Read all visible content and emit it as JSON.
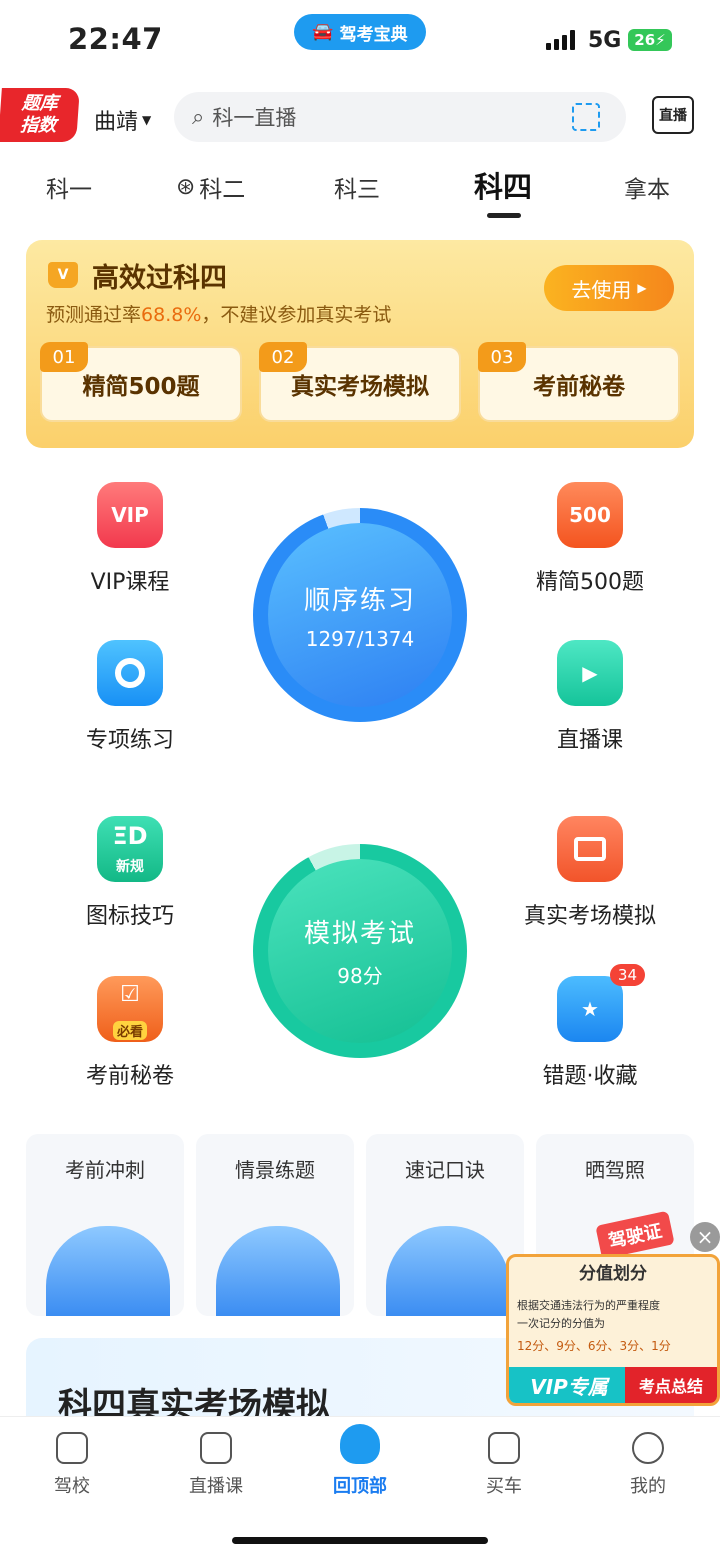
{
  "status_bar": {
    "time": "22:47",
    "app_name": "驾考宝典",
    "network": "5G",
    "battery": "26"
  },
  "header": {
    "badge_line1": "题库",
    "badge_line2": "指数",
    "city": "曲靖",
    "search_placeholder": "科一直播",
    "tv_label": "直播"
  },
  "tabs": [
    "科一",
    "科二",
    "科三",
    "科四",
    "拿本"
  ],
  "active_tab": "科四",
  "banner": {
    "title": "高效过科四",
    "subtitle_prefix": "预测通过率",
    "pass_rate": "68.8%",
    "subtitle_suffix": "，不建议参加真实考试",
    "button": "去使用",
    "cards": [
      {
        "num": "01",
        "label": "精简500题"
      },
      {
        "num": "02",
        "label": "真实考场模拟"
      },
      {
        "num": "03",
        "label": "考前秘卷"
      }
    ]
  },
  "features": {
    "vip": {
      "label": "VIP课程",
      "icon_text": "VIP"
    },
    "jingjian": {
      "label": "精简500题",
      "icon_text": "500"
    },
    "zhuanxiang": {
      "label": "专项练习"
    },
    "zhibo": {
      "label": "直播课"
    },
    "tubiao": {
      "label": "图标技巧",
      "icon_text": "新规"
    },
    "zhenshi": {
      "label": "真实考场模拟"
    },
    "mijuan": {
      "label": "考前秘卷",
      "icon_text": "必看"
    },
    "cuoti": {
      "label": "错题·收藏",
      "badge": "34"
    }
  },
  "practice_circle": {
    "title": "顺序练习",
    "progress": "1297/1374",
    "progress_fraction": 0.944
  },
  "exam_circle": {
    "title": "模拟考试",
    "score": "98分"
  },
  "mini_cards": [
    "考前冲刺",
    "情景练题",
    "速记口诀",
    "晒驾照"
  ],
  "license_stamp": "驾驶证",
  "promo": {
    "title": "科四真实考场模拟"
  },
  "float_video": {
    "title": "分值划分",
    "line1": "根据交通违法行为的严重程度",
    "line2": "一次记分的分值为",
    "values": "12分、9分、6分、3分、1分",
    "vip": "VIP专属",
    "tag": "考点总结"
  },
  "bottom_nav": [
    {
      "label": "驾校"
    },
    {
      "label": "直播课"
    },
    {
      "label": "回顶部"
    },
    {
      "label": "买车"
    },
    {
      "label": "我的"
    }
  ],
  "colors": {
    "brand_blue": "#1e9bf0",
    "orange": "#f5871b",
    "green": "#2ed3a8"
  }
}
